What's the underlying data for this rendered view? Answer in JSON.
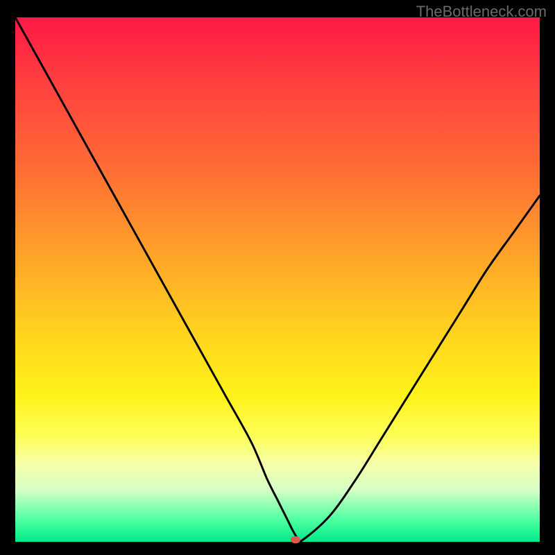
{
  "watermark": "TheBottleneck.com",
  "chart_data": {
    "type": "line",
    "title": "",
    "xlabel": "",
    "ylabel": "",
    "xlim": [
      0,
      100
    ],
    "ylim": [
      0,
      100
    ],
    "x": [
      0,
      5,
      10,
      15,
      20,
      25,
      30,
      35,
      40,
      45,
      48,
      50,
      52,
      53,
      54,
      55,
      60,
      65,
      70,
      75,
      80,
      85,
      90,
      95,
      100
    ],
    "values": [
      100,
      91,
      82,
      73,
      64,
      55,
      46,
      37,
      28,
      19,
      12,
      8,
      4,
      2,
      0.5,
      0.5,
      5,
      12,
      20,
      28,
      36,
      44,
      52,
      59,
      66
    ],
    "marker": {
      "x": 53.5,
      "y": 0.4,
      "color": "#d85a4a"
    },
    "curve_color": "#000000",
    "curve_width": 3
  }
}
